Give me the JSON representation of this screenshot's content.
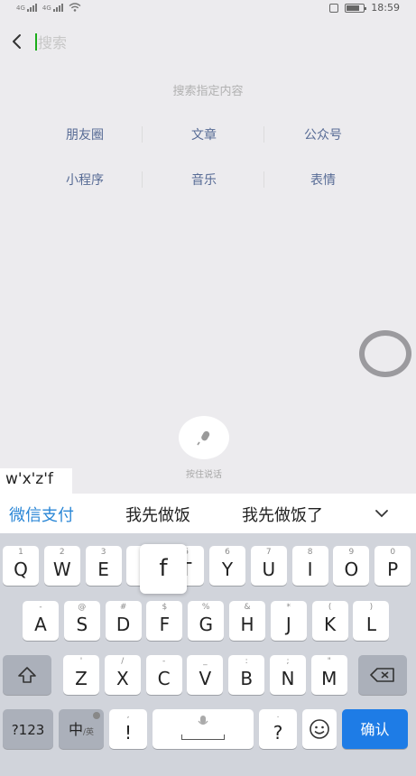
{
  "status_bar": {
    "left_tag_1": "4G",
    "left_tag_2": "4G",
    "time": "18:59",
    "battery_level": 0.75
  },
  "search": {
    "placeholder": "搜索",
    "value": ""
  },
  "search_in": {
    "title": "搜索指定内容",
    "categories": [
      {
        "label": "朋友圈"
      },
      {
        "label": "文章"
      },
      {
        "label": "公众号"
      },
      {
        "label": "小程序"
      },
      {
        "label": "音乐"
      },
      {
        "label": "表情"
      }
    ]
  },
  "voice": {
    "label": "按住说话"
  },
  "ime": {
    "composition": "w'x'z'f",
    "candidates": [
      "微信支付",
      "我先做饭",
      "我先做饭了"
    ],
    "popup_key": "f",
    "row1": [
      {
        "key": "Q",
        "hint": "1"
      },
      {
        "key": "W",
        "hint": "2"
      },
      {
        "key": "E",
        "hint": "3"
      },
      {
        "key": "R",
        "hint": "4"
      },
      {
        "key": "T",
        "hint": "5"
      },
      {
        "key": "Y",
        "hint": "6"
      },
      {
        "key": "U",
        "hint": "7"
      },
      {
        "key": "I",
        "hint": "8"
      },
      {
        "key": "O",
        "hint": "9"
      },
      {
        "key": "P",
        "hint": "0"
      }
    ],
    "row2": [
      {
        "key": "A",
        "hint": "-"
      },
      {
        "key": "S",
        "hint": "@"
      },
      {
        "key": "D",
        "hint": "#"
      },
      {
        "key": "F",
        "hint": "$"
      },
      {
        "key": "G",
        "hint": "%"
      },
      {
        "key": "H",
        "hint": "&"
      },
      {
        "key": "J",
        "hint": "*"
      },
      {
        "key": "K",
        "hint": "("
      },
      {
        "key": "L",
        "hint": ")"
      }
    ],
    "row3": [
      {
        "key": "Z",
        "hint": "'"
      },
      {
        "key": "X",
        "hint": "/"
      },
      {
        "key": "C",
        "hint": "-"
      },
      {
        "key": "V",
        "hint": "_"
      },
      {
        "key": "B",
        "hint": ":"
      },
      {
        "key": "N",
        "hint": ";"
      },
      {
        "key": "M",
        "hint": "\""
      }
    ],
    "num_key": "?123",
    "lang_key": "中",
    "lang_sub": "/英",
    "excl_key": "!",
    "excl_hint": ",",
    "question_key": "?",
    "question_hint": ".",
    "confirm_key": "确认"
  }
}
